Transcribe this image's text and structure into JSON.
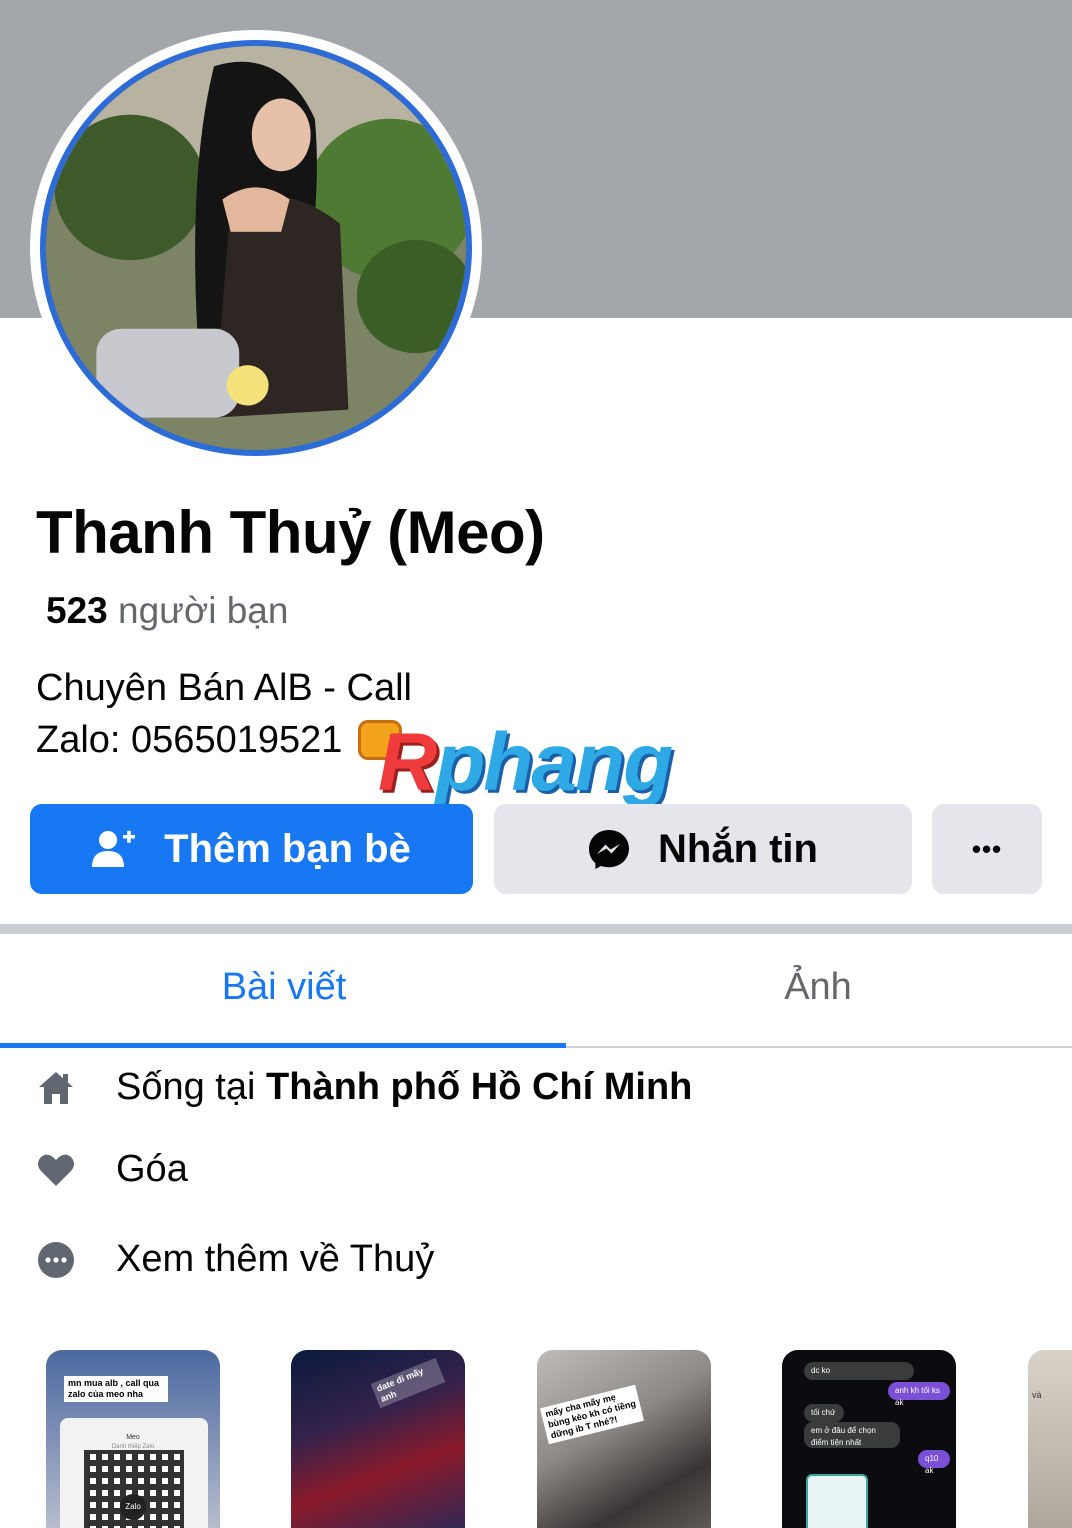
{
  "profile": {
    "name": "Thanh Thuỷ (Meo)",
    "friends_count": "523",
    "friends_label": "người bạn",
    "bio_line1": "Chuyên Bán AlB - Call",
    "bio_line2": "Zalo: 0565019521"
  },
  "watermark": {
    "first": "R",
    "rest": "phang"
  },
  "actions": {
    "add_friend_label": "Thêm bạn bè",
    "message_label": "Nhắn tin",
    "more_label": "•••"
  },
  "tabs": [
    {
      "label": "Bài viết",
      "active": true
    },
    {
      "label": "Ảnh",
      "active": false
    }
  ],
  "info": {
    "lives_prefix": "Sống tại",
    "lives_city": "Thành phố Hồ Chí Minh",
    "relationship": "Góa",
    "see_more": "Xem thêm về Thuỷ"
  },
  "thumbnails": [
    {
      "caption": "mn mua alb , call qua zalo của meo nha",
      "sub_name": "Meo",
      "sub_text": "Danh thiếp Zalo",
      "badge": "Zalo"
    },
    {
      "caption": "date đi mấy anh"
    },
    {
      "caption": "mấy cha mấy mẹ bùng kèo kh có tiềng dững ib T nhé?!"
    },
    {
      "messages": [
        "dc ko",
        "anh kh tối ks ak",
        "tối chứ",
        "em ở đâu để chọn điểm tiện nhất",
        "q10 ak"
      ]
    },
    {
      "caption": "và"
    }
  ],
  "colors": {
    "accent": "#1877f2",
    "cover": "#a3a6aa",
    "avatar_ring": "#2d6cd6",
    "secondary_text": "#65676b",
    "button_gray": "#e4e6eb"
  },
  "icons": {
    "add_friend": "person-plus-icon",
    "messenger": "messenger-icon",
    "more": "ellipsis-icon",
    "home": "home-icon",
    "heart": "heart-icon",
    "see_more": "dots-circle-icon"
  }
}
